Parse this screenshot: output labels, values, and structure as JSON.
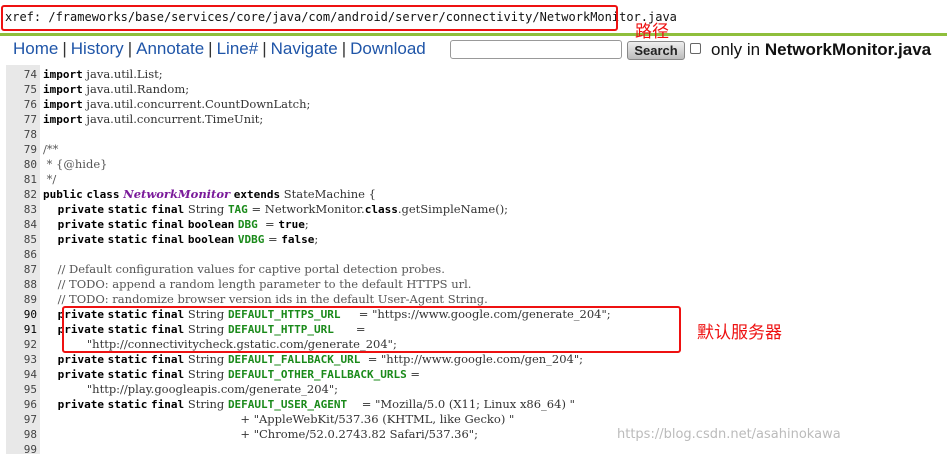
{
  "path": "xref: /frameworks/base/services/core/java/com/android/server/connectivity/NetworkMonitor.java",
  "annotations": {
    "path_label": "路径",
    "server_label": "默认服务器"
  },
  "nav": {
    "home": "Home",
    "history": "History",
    "annotate": "Annotate",
    "line": "Line#",
    "navigate": "Navigate",
    "download": "Download",
    "search_placeholder": "",
    "search_button": "Search",
    "only_in": "only in",
    "only_file": "NetworkMonitor.java"
  },
  "code": [
    {
      "n": "74",
      "s": "import java.util.List;"
    },
    {
      "n": "75",
      "s": "import java.util.Random;"
    },
    {
      "n": "76",
      "s": "import java.util.concurrent.CountDownLatch;"
    },
    {
      "n": "77",
      "s": "import java.util.concurrent.TimeUnit;"
    },
    {
      "n": "78",
      "s": ""
    },
    {
      "n": "79",
      "s": "/**"
    },
    {
      "n": "80",
      "s": " * {@hide}"
    },
    {
      "n": "81",
      "s": " */"
    },
    {
      "n": "82",
      "s": "public class NetworkMonitor extends StateMachine {"
    },
    {
      "n": "83",
      "s": "    private static final String TAG = NetworkMonitor.class.getSimpleName();"
    },
    {
      "n": "84",
      "s": "    private static final boolean DBG  = true;"
    },
    {
      "n": "85",
      "s": "    private static final boolean VDBG = false;"
    },
    {
      "n": "86",
      "s": ""
    },
    {
      "n": "87",
      "s": "    // Default configuration values for captive portal detection probes."
    },
    {
      "n": "88",
      "s": "    // TODO: append a random length parameter to the default HTTPS url."
    },
    {
      "n": "89",
      "s": "    // TODO: randomize browser version ids in the default User-Agent String."
    },
    {
      "n": "90",
      "s": "    private static final String DEFAULT_HTTPS_URL     = \"https://www.google.com/generate_204\";"
    },
    {
      "n": "91",
      "s": "    private static final String DEFAULT_HTTP_URL      ="
    },
    {
      "n": "92",
      "s": "            \"http://connectivitycheck.gstatic.com/generate_204\";"
    },
    {
      "n": "93",
      "s": "    private static final String DEFAULT_FALLBACK_URL  = \"http://www.google.com/gen_204\";"
    },
    {
      "n": "94",
      "s": "    private static final String DEFAULT_OTHER_FALLBACK_URLS ="
    },
    {
      "n": "95",
      "s": "            \"http://play.googleapis.com/generate_204\";"
    },
    {
      "n": "96",
      "s": "    private static final String DEFAULT_USER_AGENT    = \"Mozilla/5.0 (X11; Linux x86_64) \""
    },
    {
      "n": "97",
      "s": "                                                      + \"AppleWebKit/537.36 (KHTML, like Gecko) \""
    },
    {
      "n": "98",
      "s": "                                                      + \"Chrome/52.0.2743.82 Safari/537.36\";"
    },
    {
      "n": "99",
      "s": ""
    }
  ],
  "watermark": "https://blog.csdn.net/asahinokawa",
  "colors": {
    "annotation_red": "#e11111",
    "nav_link": "#1f55a8",
    "path_underline": "#8fbf3c",
    "field_green": "#1a8a1a"
  }
}
